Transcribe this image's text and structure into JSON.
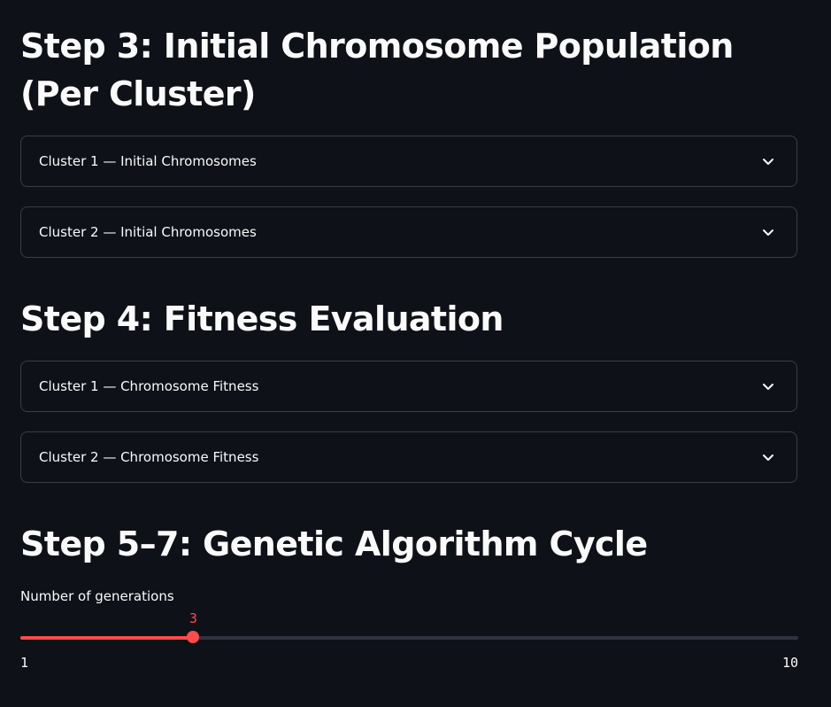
{
  "sections": {
    "step3": {
      "title": "Step 3: Initial Chromosome Population (Per Cluster)",
      "expanders": [
        {
          "label": "Cluster 1 — Initial Chromosomes"
        },
        {
          "label": "Cluster 2 — Initial Chromosomes"
        }
      ]
    },
    "step4": {
      "title": "Step 4: Fitness Evaluation",
      "expanders": [
        {
          "label": "Cluster 1 — Chromosome Fitness"
        },
        {
          "label": "Cluster 2 — Chromosome Fitness"
        }
      ]
    },
    "step5": {
      "title": "Step 5–7: Genetic Algorithm Cycle"
    }
  },
  "slider": {
    "label": "Number of generations",
    "value": 3,
    "min": 1,
    "max": 10,
    "value_text": "3",
    "min_text": "1",
    "max_text": "10"
  },
  "icons": {
    "expander_chevron": "chevron-down-icon"
  },
  "colors": {
    "background": "#0e1117",
    "text": "#fafafa",
    "accent": "#ff4b4b",
    "border": "#3a3d45",
    "track": "#31333f"
  }
}
